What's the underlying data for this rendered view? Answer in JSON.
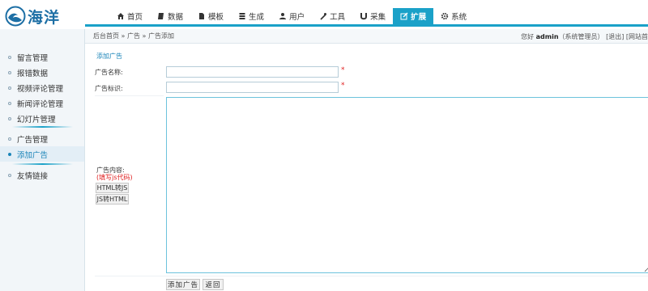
{
  "brand": {
    "logo_text": "海洋",
    "accent": "#1aa1c8",
    "logo_color": "#1d6fa5"
  },
  "nav": [
    {
      "label": "首页",
      "icon": "home-icon"
    },
    {
      "label": "数据",
      "icon": "book-icon"
    },
    {
      "label": "模板",
      "icon": "file-icon"
    },
    {
      "label": "生成",
      "icon": "server-icon"
    },
    {
      "label": "用户",
      "icon": "user-icon"
    },
    {
      "label": "工具",
      "icon": "wrench-icon"
    },
    {
      "label": "采集",
      "icon": "magnet-icon"
    },
    {
      "label": "扩展",
      "icon": "edit-icon",
      "active": true
    },
    {
      "label": "系统",
      "icon": "gear-icon"
    }
  ],
  "breadcrumb": "后台首页 » 广告 » 广告添加",
  "user": {
    "greeting": "您好",
    "name": "admin",
    "role": "（系统管理员）",
    "logout": "[退出]",
    "site": "[网站首"
  },
  "sidebar": {
    "group1": [
      "留言管理",
      "报错数据",
      "视频评论管理",
      "新闻评论管理",
      "幻灯片管理"
    ],
    "group2": [
      "广告管理",
      "添加广告"
    ],
    "group3": [
      "友情链接"
    ],
    "active": "添加广告"
  },
  "form": {
    "title": "添加广告",
    "name_label": "广告名称:",
    "name_value": "",
    "id_label": "广告标识:",
    "id_value": "",
    "required_mark": "*",
    "content_label": "广告内容:",
    "content_hint": "(填写js代码)",
    "content_value": "",
    "html_to_js": "HTML转JS",
    "js_to_html": "JS转HTML",
    "submit": "添加广告",
    "back": "返回"
  }
}
